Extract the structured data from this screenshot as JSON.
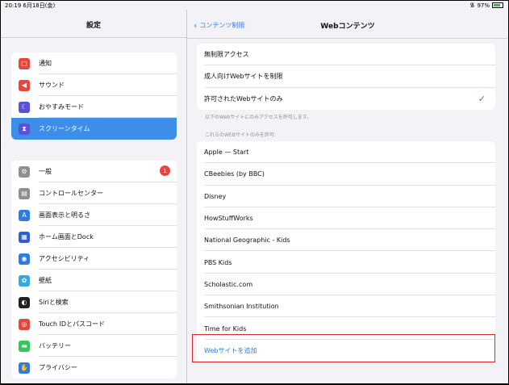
{
  "status_bar": {
    "time": "20:19  6月18日(金)",
    "battery": "97%"
  },
  "sidebar": {
    "title": "設定",
    "group1": [
      {
        "label": "通知",
        "icon": "notification-icon",
        "color": "#e9453d"
      },
      {
        "label": "サウンド",
        "icon": "sound-icon",
        "color": "#e9453d"
      },
      {
        "label": "おやすみモード",
        "icon": "moon-icon",
        "color": "#5b50d6"
      },
      {
        "label": "スクリーンタイム",
        "icon": "hourglass-icon",
        "color": "#5b50d6",
        "selected": true
      }
    ],
    "group2": [
      {
        "label": "一般",
        "icon": "gear-icon",
        "color": "#8e8e93",
        "badge": "1"
      },
      {
        "label": "コントロールセンター",
        "icon": "switch-icon",
        "color": "#8e8e93"
      },
      {
        "label": "画面表示と明るさ",
        "icon": "text-size-icon",
        "color": "#2f7be0"
      },
      {
        "label": "ホーム画面とDock",
        "icon": "grid-icon",
        "color": "#2f5fd6"
      },
      {
        "label": "アクセシビリティ",
        "icon": "accessibility-icon",
        "color": "#2f7be0"
      },
      {
        "label": "壁紙",
        "icon": "flower-icon",
        "color": "#35aadc"
      },
      {
        "label": "Siriと検索",
        "icon": "siri-icon",
        "color": "#222"
      },
      {
        "label": "Touch IDとパスコード",
        "icon": "fingerprint-icon",
        "color": "#e9453d"
      },
      {
        "label": "バッテリー",
        "icon": "battery-icon",
        "color": "#34c759"
      },
      {
        "label": "プライバシー",
        "icon": "hand-icon",
        "color": "#2f7be0"
      }
    ]
  },
  "detail": {
    "back_label": "コンテンツ制限",
    "title": "Webコンテンツ",
    "options": [
      "無制限アクセス",
      "成人向けWebサイトを制限",
      "許可されたWebサイトのみ"
    ],
    "selected_option": "許可されたWebサイトのみ",
    "note1": "以下のWebサイトにのみアクセスを許可します。",
    "note2": "これらのWEBサイトのみを許可:",
    "sites": [
      "Apple — Start",
      "CBeebies (by BBC)",
      "Disney",
      "HowStuffWorks",
      "National Geographic - Kids",
      "PBS Kids",
      "Scholastic.com",
      "Smithsonian Institution",
      "Time for Kids"
    ],
    "add_site_label": "Webサイトを追加"
  },
  "colors": {
    "accent": "#2f7be0",
    "selected_row": "#3d8ee8",
    "highlight_box": "#d9292e"
  }
}
